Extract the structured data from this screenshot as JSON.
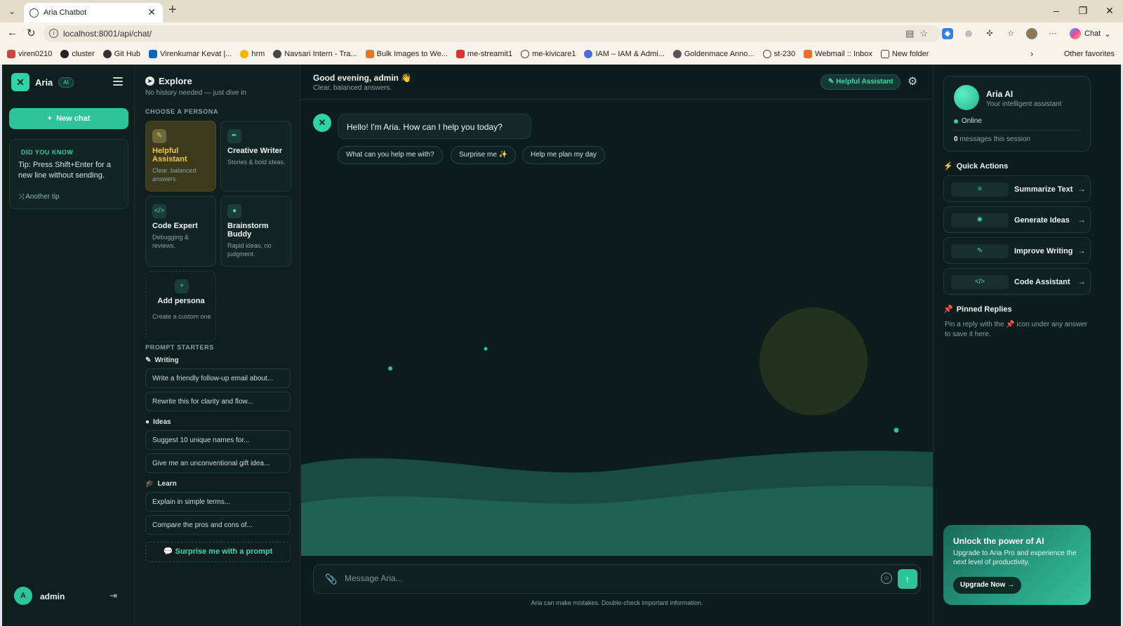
{
  "browser": {
    "tab_title": "Aria Chatbot",
    "url": "localhost:8001/api/chat/",
    "chat_label": "Chat",
    "bookmarks": [
      "viren0210",
      "cluster",
      "Git Hub",
      "Virenkumar Kevat |...",
      "hrm",
      "Navsari Intern - Tra...",
      "Bulk Images to We...",
      "me-streamit1",
      "me-kivicare1",
      "IAM – IAM & Admi...",
      "Goldenmace Anno...",
      "st-230",
      "Webmail :: Inbox",
      "New folder"
    ],
    "other_favorites": "Other favorites"
  },
  "sidebar": {
    "brand": "Aria",
    "badge": "AI",
    "new_chat": "New chat",
    "tip_heading": "DID YOU KNOW",
    "tip_text": "Tip: Press Shift+Enter for a new line without sending.",
    "tip_link": "Another tip",
    "user_initial": "A",
    "user_name": "admin"
  },
  "explore": {
    "title": "Explore",
    "subtitle": "No history needed — just dive in",
    "persona_label": "CHOOSE A PERSONA",
    "personas": [
      {
        "name": "Helpful Assistant",
        "desc": "Clear, balanced answers."
      },
      {
        "name": "Creative Writer",
        "desc": "Stories & bold ideas."
      },
      {
        "name": "Code Expert",
        "desc": "Debugging & reviews."
      },
      {
        "name": "Brainstorm Buddy",
        "desc": "Rapid ideas, no judgment."
      },
      {
        "name": "Add persona",
        "desc": "Create a custom one"
      }
    ],
    "starters_label": "PROMPT STARTERS",
    "categories": [
      {
        "name": "Writing",
        "prompts": [
          "Write a friendly follow-up email about...",
          "Rewrite this for clarity and flow..."
        ]
      },
      {
        "name": "Ideas",
        "prompts": [
          "Suggest 10 unique names for...",
          "Give me an unconventional gift idea..."
        ]
      },
      {
        "name": "Learn",
        "prompts": [
          "Explain in simple terms...",
          "Compare the pros and cons of..."
        ]
      }
    ],
    "surprise": "Surprise me with a prompt"
  },
  "main": {
    "greeting": "Good evening, admin 👋",
    "greeting_sub": "Clear, balanced answers.",
    "persona_pill": "Helpful Assistant",
    "bot_message": "Hello! I'm Aria. How can I help you today?",
    "chips": [
      "What can you help me with?",
      "Surprise me ✨",
      "Help me plan my day"
    ],
    "input_placeholder": "Message Aria...",
    "disclaimer": "Aria can make mistakes. Double-check important information."
  },
  "right": {
    "name": "Aria AI",
    "subtitle": "Your intelligent assistant",
    "status": "Online",
    "msg_count": "0",
    "msg_suffix": "messages this session",
    "quick_title": "Quick Actions",
    "quick_actions": [
      "Summarize Text",
      "Generate Ideas",
      "Improve Writing",
      "Code Assistant"
    ],
    "pinned_title": "Pinned Replies",
    "pinned_text_a": "Pin a reply with the",
    "pinned_text_b": "icon under any answer to save it here.",
    "promo_title": "Unlock the power of AI",
    "promo_text": "Upgrade to Aria Pro and experience the next level of productivity.",
    "promo_button": "Upgrade Now"
  },
  "colors": {
    "accent": "#2ec49a",
    "background": "#0d1d1c",
    "highlight": "#f3c64a"
  }
}
